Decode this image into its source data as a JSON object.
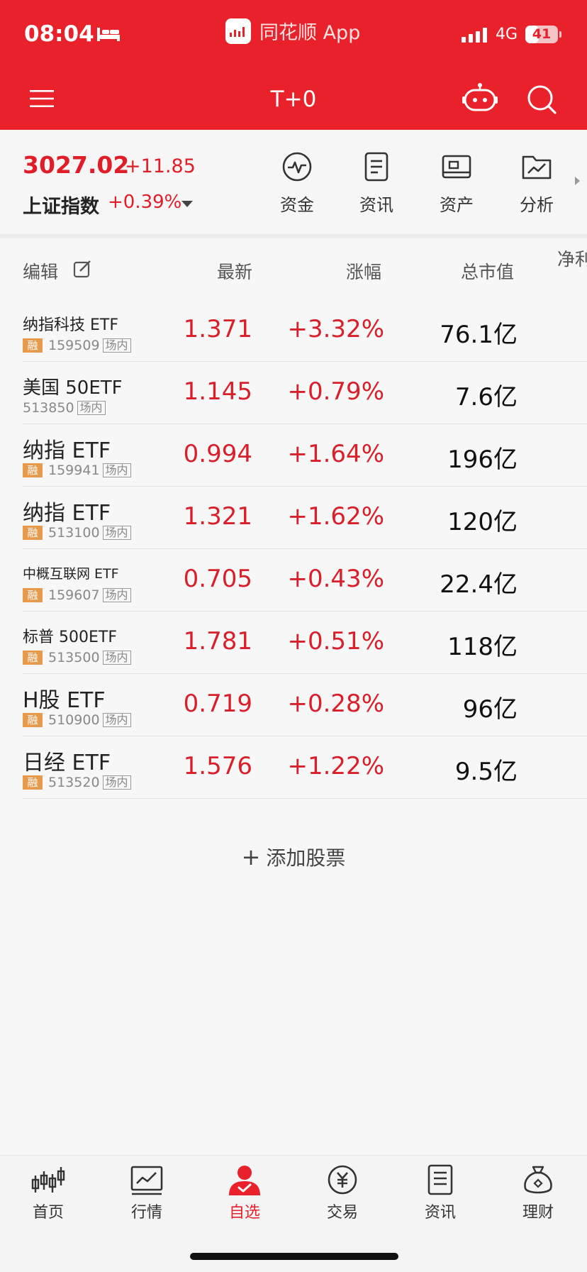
{
  "status_bar": {
    "time": "08:04",
    "app_name": "同花顺 App",
    "network": "4G",
    "battery": "41",
    "battery_level": 0.41,
    "icons": [
      "bed-icon",
      "signal-icon",
      "battery-icon"
    ]
  },
  "header": {
    "title": "T+0",
    "bg_color": "#e8212b",
    "icons": [
      "menu-icon",
      "robot-assistant-icon",
      "search-icon"
    ]
  },
  "index": {
    "value": "3027.02",
    "change": "+11.85",
    "name": "上证指数",
    "pct": "+0.39%",
    "color": "#e01e28"
  },
  "quick_actions": [
    {
      "label": "资金",
      "icon": "pulse-icon"
    },
    {
      "label": "资讯",
      "icon": "document-icon"
    },
    {
      "label": "资产",
      "icon": "wallet-card-icon"
    },
    {
      "label": "分析",
      "icon": "folder-chart-icon"
    }
  ],
  "table": {
    "edit_label": "编辑",
    "headers": {
      "latest": "最新",
      "pct": "涨幅",
      "cap": "总市值",
      "extra": "净利"
    },
    "rows": [
      {
        "name": "纳指科技 ETF",
        "rong": "融",
        "code": "159509",
        "place": "场内",
        "latest": "1.371",
        "pct": "+3.32%",
        "cap": "76.1亿"
      },
      {
        "name": "美国 50ETF",
        "rong": "",
        "code": "513850",
        "place": "场内",
        "latest": "1.145",
        "pct": "+0.79%",
        "cap": "7.6亿"
      },
      {
        "name": "纳指 ETF",
        "rong": "融",
        "code": "159941",
        "place": "场内",
        "latest": "0.994",
        "pct": "+1.64%",
        "cap": "196亿"
      },
      {
        "name": "纳指 ETF",
        "rong": "融",
        "code": "513100",
        "place": "场内",
        "latest": "1.321",
        "pct": "+1.62%",
        "cap": "120亿"
      },
      {
        "name": "中概互联网 ETF",
        "rong": "融",
        "code": "159607",
        "place": "场内",
        "latest": "0.705",
        "pct": "+0.43%",
        "cap": "22.4亿"
      },
      {
        "name": "标普 500ETF",
        "rong": "融",
        "code": "513500",
        "place": "场内",
        "latest": "1.781",
        "pct": "+0.51%",
        "cap": "118亿"
      },
      {
        "name": "H股 ETF",
        "rong": "融",
        "code": "510900",
        "place": "场内",
        "latest": "0.719",
        "pct": "+0.28%",
        "cap": "96亿"
      },
      {
        "name": "日经 ETF",
        "rong": "融",
        "code": "513520",
        "place": "场内",
        "latest": "1.576",
        "pct": "+1.22%",
        "cap": "9.5亿"
      }
    ],
    "up_color": "#d8202a"
  },
  "add_stock": {
    "plus": "+",
    "label": "添加股票"
  },
  "bottom_nav": [
    {
      "label": "首页",
      "icon": "candlestick-icon",
      "active": false
    },
    {
      "label": "行情",
      "icon": "market-chart-icon",
      "active": false
    },
    {
      "label": "自选",
      "icon": "watchlist-person-icon",
      "active": true
    },
    {
      "label": "交易",
      "icon": "yuan-coin-icon",
      "active": false
    },
    {
      "label": "资讯",
      "icon": "news-doc-icon",
      "active": false
    },
    {
      "label": "理财",
      "icon": "money-bag-icon",
      "active": false
    }
  ],
  "accent_color": "#e8212b"
}
